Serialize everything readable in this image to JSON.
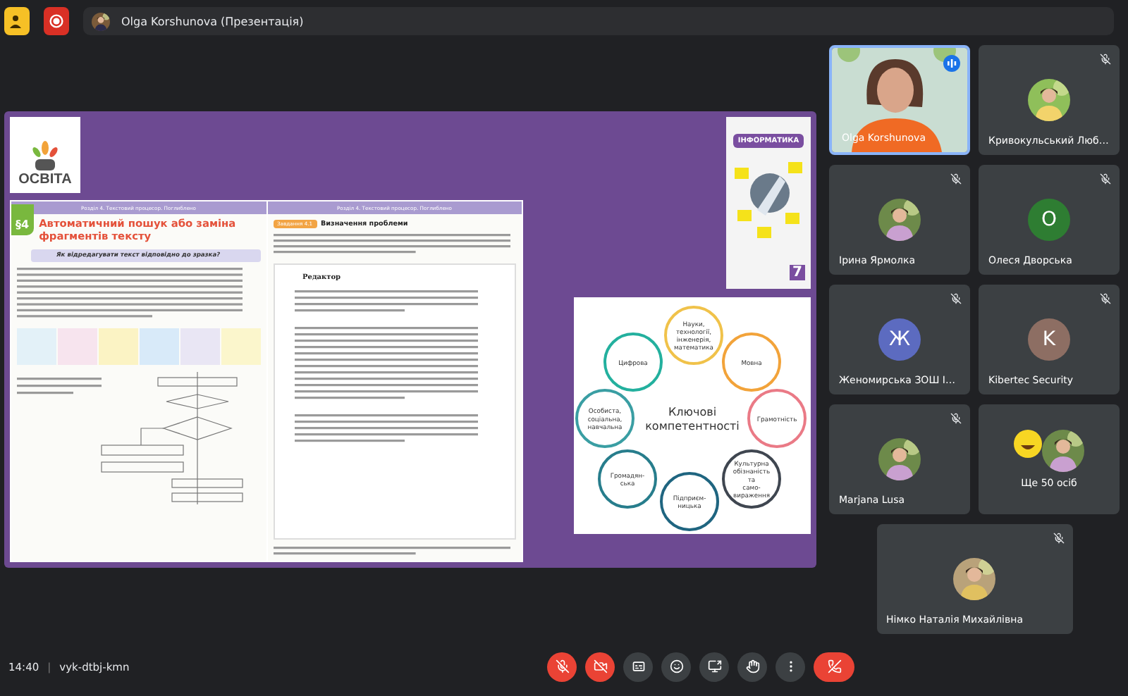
{
  "top_bar": {
    "presenter": "Olga Korshunova (Презентація)"
  },
  "slide": {
    "logo": "ОСВІТА",
    "book": {
      "left_header": "Розділ 4. Текстовий процесор. Поглиблено",
      "right_header": "Розділ 4. Текстовий процесор. Поглиблено",
      "section": "§4",
      "title": "Автоматичний пошук або заміна фрагментів тексту",
      "question": "Як відредагувати текст відповідно до зразка?",
      "task_badge": "Завдання 4.1",
      "task_heading": "Визначення проблеми",
      "sample_heading": "Редактор"
    },
    "cover": {
      "title": "ІНФОРМАТИКА",
      "grade": "7"
    },
    "diagram": {
      "title": "Ключові компетентності",
      "items": [
        {
          "label": "Науки, технології, інженерія, математика",
          "color": "#f0c24a"
        },
        {
          "label": "Цифрова",
          "color": "#23b09e"
        },
        {
          "label": "Мовна",
          "color": "#f2a33a"
        },
        {
          "label": "Особиста, соціальна, навчальна",
          "color": "#3a9ea3"
        },
        {
          "label": "Грамотність",
          "color": "#ea7a86"
        },
        {
          "label": "Громадян-ська",
          "color": "#277d8c"
        },
        {
          "label": "Культурна обізнаність та само-вираження",
          "color": "#3f4650"
        },
        {
          "label": "Підприєм-ницька",
          "color": "#1f6580"
        }
      ]
    }
  },
  "participants": [
    {
      "name": "Olga Korshunova",
      "kind": "video",
      "speaking": true
    },
    {
      "name": "Кривокульський Люб…",
      "muted": true
    },
    {
      "name": "Ірина Ярмолка",
      "muted": true
    },
    {
      "name": "Олеся Дворська",
      "kind": "letter",
      "letter": "О",
      "color": "#2e7d32",
      "muted": true
    },
    {
      "name": "Женомирська ЗОШ І…",
      "kind": "letter",
      "letter": "Ж",
      "color": "#5c6bc0",
      "muted": true
    },
    {
      "name": "Kibertec Security",
      "kind": "letter",
      "letter": "K",
      "color": "#8d6e63",
      "muted": true
    },
    {
      "name": "Marjana Lusa",
      "muted": true
    },
    {
      "name": "Ще 50 осіб",
      "kind": "more"
    },
    {
      "name": "Німко Наталія Михайлівна",
      "muted": true
    }
  ],
  "bottom_bar": {
    "time": "14:40",
    "separator": "|",
    "meeting_code": "vyk-dtbj-kmn",
    "controls": [
      {
        "kind": "mic",
        "on": false
      },
      {
        "kind": "camera",
        "on": false
      },
      {
        "kind": "captions"
      },
      {
        "kind": "reactions"
      },
      {
        "kind": "present"
      },
      {
        "kind": "hand"
      },
      {
        "kind": "more"
      },
      {
        "kind": "leave"
      }
    ]
  }
}
